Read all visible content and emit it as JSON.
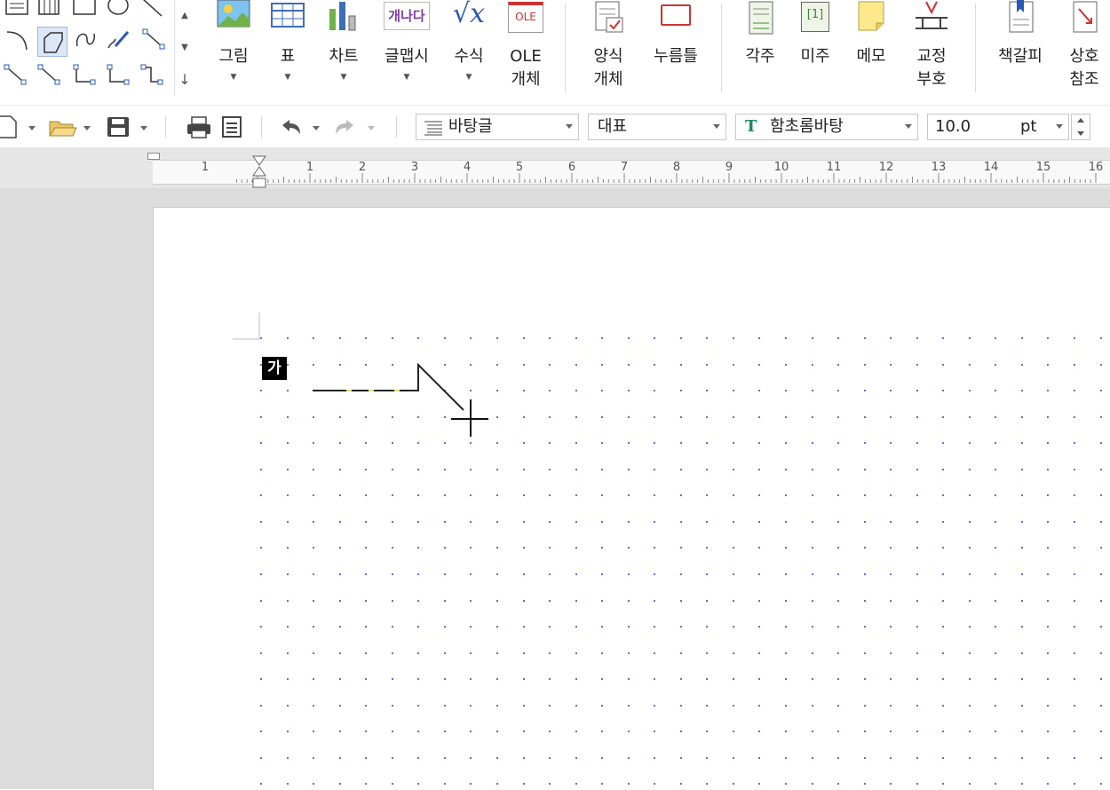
{
  "ribbon": {
    "buttons": [
      {
        "id": "picture",
        "label": "그림",
        "icon": "picture-icon"
      },
      {
        "id": "table",
        "label": "표",
        "icon": "table-icon"
      },
      {
        "id": "chart",
        "label": "차트",
        "icon": "chart-icon"
      },
      {
        "id": "wordart",
        "label": "글맵시",
        "icon": "wordart-icon",
        "icon_text": "개나다"
      },
      {
        "id": "equation",
        "label": "수식",
        "icon": "equation-icon",
        "icon_text": "√x"
      },
      {
        "id": "ole",
        "label": "OLE",
        "label2": "개체",
        "icon": "ole-icon",
        "icon_text": "OLE"
      },
      {
        "id": "form-object",
        "label": "양식",
        "label2": "개체",
        "icon": "form-object-icon"
      },
      {
        "id": "click-here",
        "label": "누름틀",
        "icon": "click-here-icon"
      },
      {
        "id": "footnote",
        "label": "각주",
        "icon": "footnote-icon"
      },
      {
        "id": "endnote",
        "label": "미주",
        "icon": "endnote-icon",
        "icon_text": "[1]"
      },
      {
        "id": "memo",
        "label": "메모",
        "icon": "memo-icon"
      },
      {
        "id": "proofreading",
        "label": "교정",
        "label2": "부호",
        "icon": "proofreading-icon"
      },
      {
        "id": "bookmark",
        "label": "책갈피",
        "icon": "bookmark-icon"
      },
      {
        "id": "cross-reference",
        "label": "상호",
        "label2": "참조",
        "icon": "cross-reference-icon"
      }
    ],
    "scroll": {
      "up": "▲",
      "down": "▼",
      "more": "↓"
    }
  },
  "toolbar": {
    "style_combo": "바탕글",
    "language_combo": "대표",
    "font_combo": "함초롬바탕",
    "font_size": "10.0",
    "font_unit": "pt",
    "font_icon_text": "T"
  },
  "ruler": {
    "numbers": [
      "1",
      "1",
      "2",
      "3",
      "4",
      "5",
      "6",
      "7",
      "8",
      "9",
      "10",
      "11",
      "12",
      "13",
      "14",
      "15",
      "16"
    ]
  },
  "document": {
    "char_badge": "가"
  }
}
